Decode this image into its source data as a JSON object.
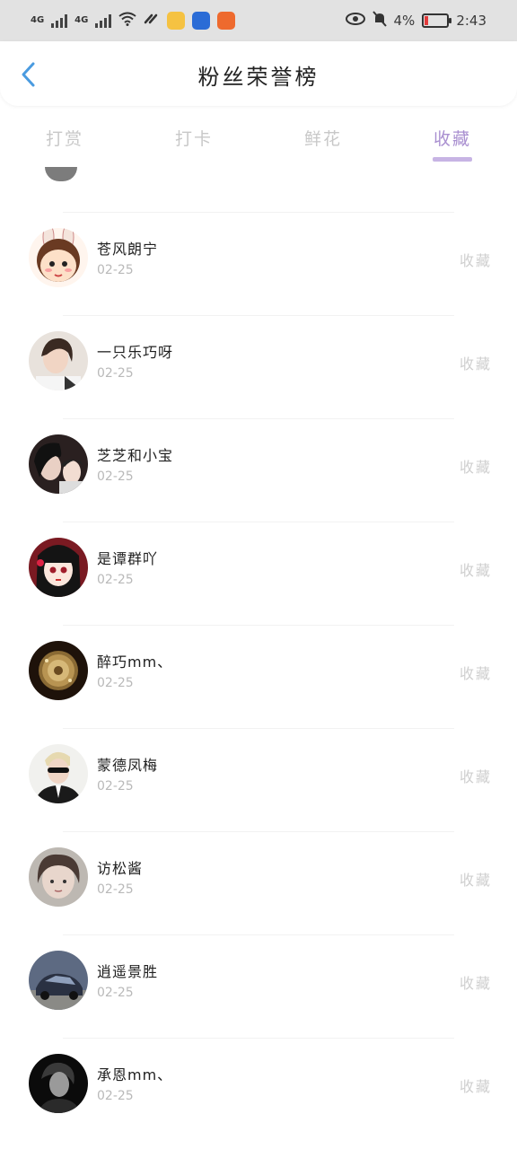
{
  "status_bar": {
    "net1": "4G",
    "net2": "4G",
    "battery_percent": "4%",
    "time": "2:43"
  },
  "header": {
    "title": "粉丝荣誉榜"
  },
  "tabs": [
    {
      "label": "打赏"
    },
    {
      "label": "打卡"
    },
    {
      "label": "鲜花"
    },
    {
      "label": "收藏"
    }
  ],
  "active_tab": "收藏",
  "rows": [
    {
      "name": "苍风朗宁",
      "date": "02-25",
      "action": "收藏"
    },
    {
      "name": "一只乐巧呀",
      "date": "02-25",
      "action": "收藏"
    },
    {
      "name": "芝芝和小宝",
      "date": "02-25",
      "action": "收藏"
    },
    {
      "name": "是谭群吖",
      "date": "02-25",
      "action": "收藏"
    },
    {
      "name": "醉巧mm、",
      "date": "02-25",
      "action": "收藏"
    },
    {
      "name": "蒙德凤梅",
      "date": "02-25",
      "action": "收藏"
    },
    {
      "name": "访松酱",
      "date": "02-25",
      "action": "收藏"
    },
    {
      "name": "逍遥景胜",
      "date": "02-25",
      "action": "收藏"
    },
    {
      "name": "承恩mm、",
      "date": "02-25",
      "action": "收藏"
    }
  ],
  "colors": {
    "accent": "#a98fd0",
    "back": "#4a9be0"
  }
}
